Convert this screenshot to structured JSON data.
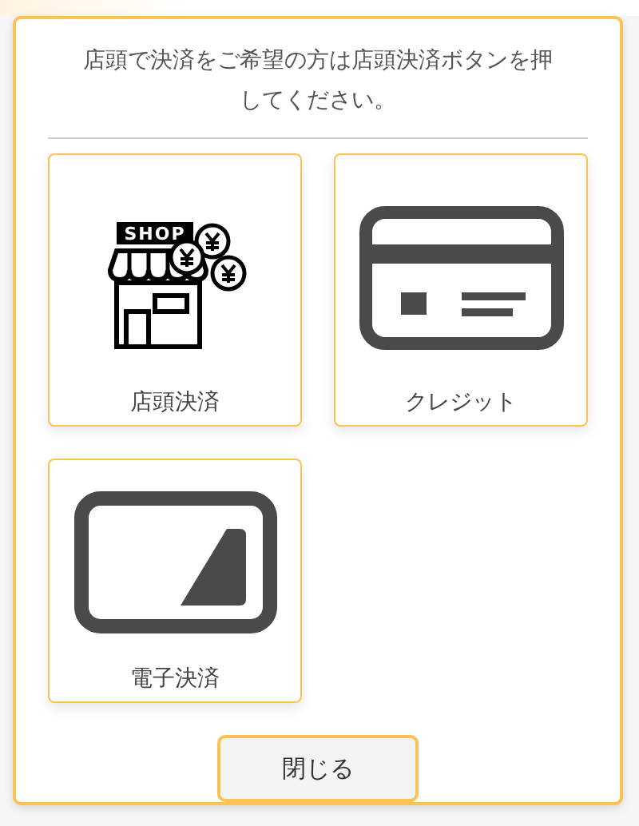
{
  "dialog": {
    "message": "店頭で決済をご希望の方は店頭決済ボタンを押してください。",
    "options": [
      {
        "kind": "shop",
        "label": "店頭決済",
        "sign": "SHOP"
      },
      {
        "kind": "card",
        "label": "クレジット"
      },
      {
        "kind": "emoney",
        "label": "電子決済"
      }
    ],
    "close_button": "閉じる"
  }
}
